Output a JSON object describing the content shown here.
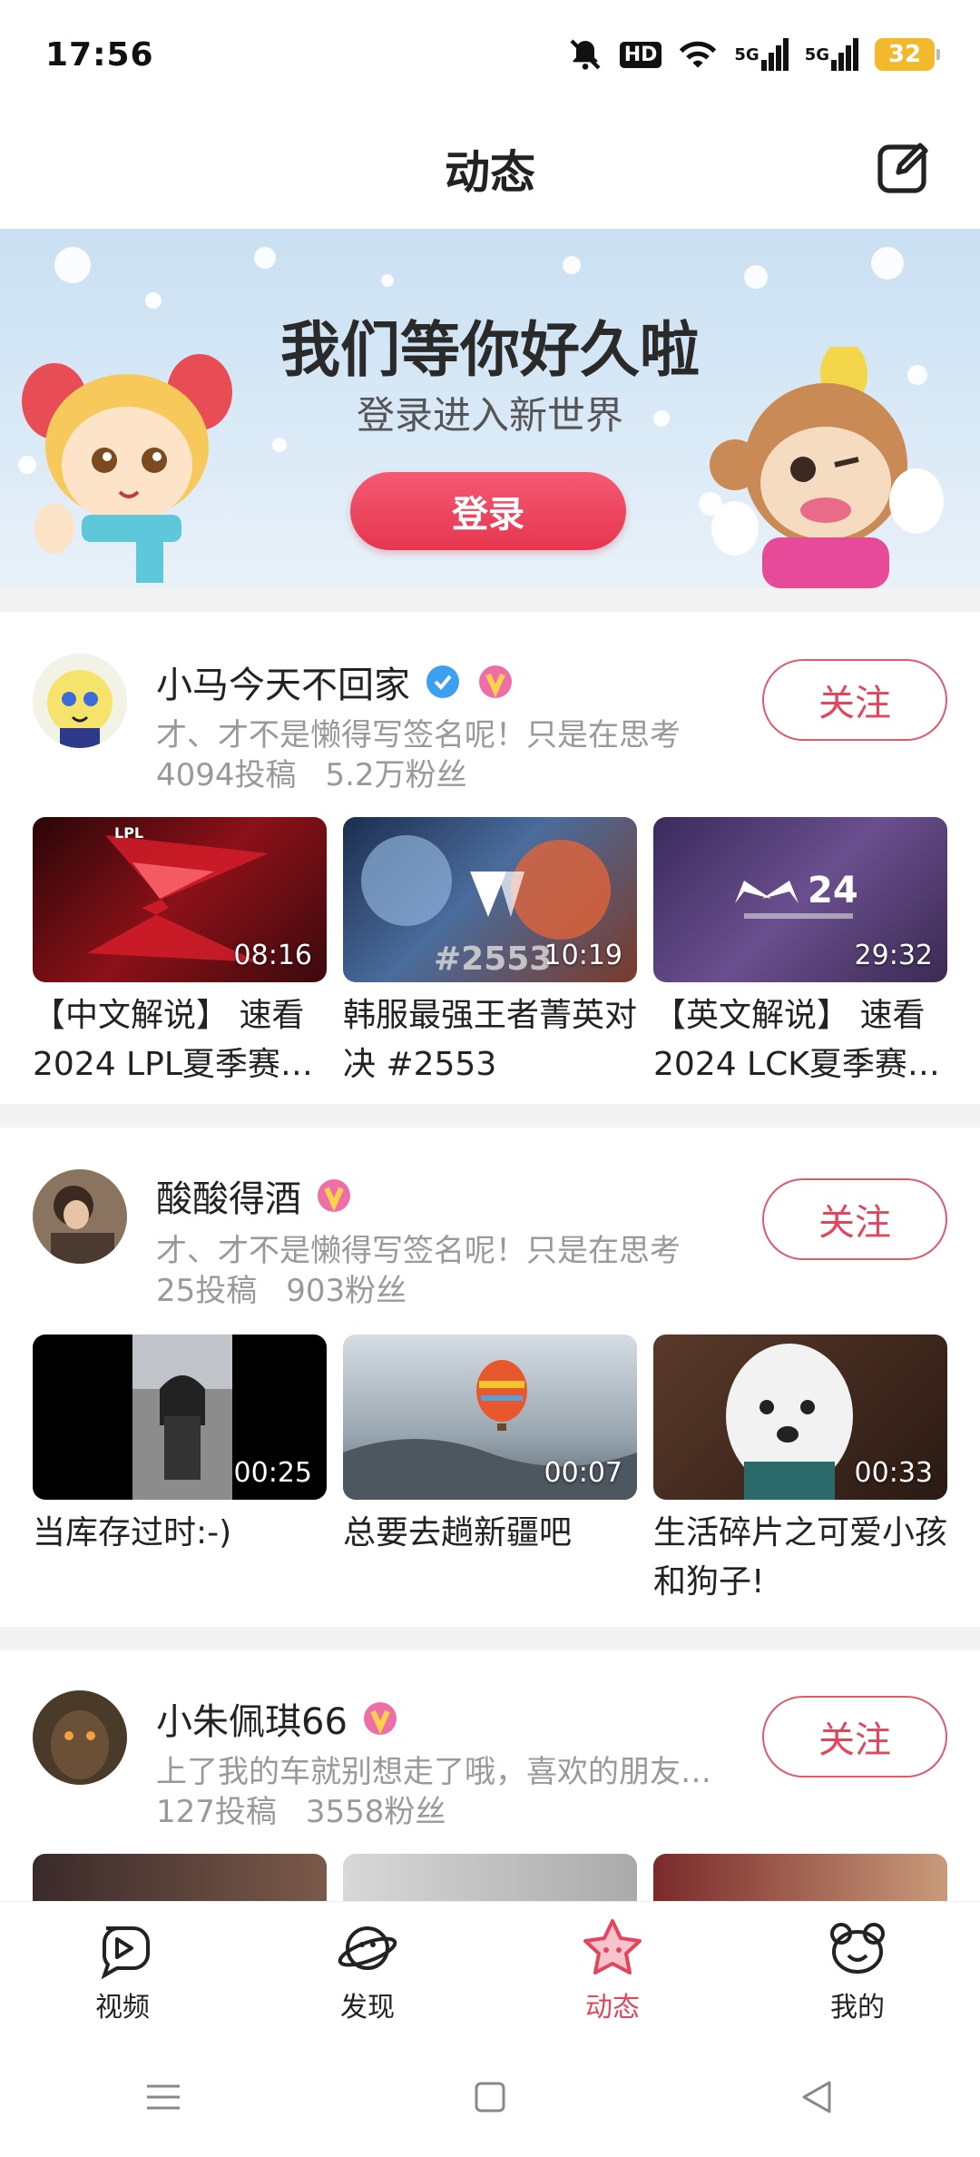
{
  "status_bar": {
    "time": "17:56",
    "hd_label": "HD",
    "net1": "5G",
    "net2": "5G",
    "battery": "32"
  },
  "header": {
    "title": "动态",
    "edit_icon": "edit-icon"
  },
  "banner": {
    "headline": "我们等你好久啦",
    "subline": "登录进入新世界",
    "login_label": "登录"
  },
  "creators": [
    {
      "name": "小马今天不回家",
      "signature": "才、才不是懒得写签名呢！只是在思考",
      "posts": "4094投稿",
      "fans": "5.2万粉丝",
      "follow_label": "关注",
      "videos": [
        {
          "title": "【中文解说】 速看2024 LPL夏季赛…",
          "duration": "08:16",
          "thumb_text": "LPL"
        },
        {
          "title": "韩服最强王者菁英对决 #2553",
          "duration": "10:19",
          "thumb_text": "#2553"
        },
        {
          "title": "【英文解说】 速看2024 LCK夏季赛…",
          "duration": "29:32",
          "thumb_text": "24"
        }
      ]
    },
    {
      "name": "酸酸得酒",
      "signature": "才、才不是懒得写签名呢！只是在思考",
      "posts": "25投稿",
      "fans": "903粉丝",
      "follow_label": "关注",
      "videos": [
        {
          "title": "当库存过时:-)",
          "duration": "00:25"
        },
        {
          "title": "总要去趟新疆吧",
          "duration": "00:07"
        },
        {
          "title": "生活碎片之可爱小孩和狗子!",
          "duration": "00:33"
        }
      ]
    },
    {
      "name": "小朱佩琪66",
      "signature": "上了我的车就别想走了哦，喜欢的朋友…",
      "posts": "127投稿",
      "fans": "3558粉丝",
      "follow_label": "关注"
    }
  ],
  "bottom_nav": [
    {
      "label": "视频",
      "icon": "video-icon",
      "active": false
    },
    {
      "label": "发现",
      "icon": "planet-icon",
      "active": false
    },
    {
      "label": "动态",
      "icon": "star-icon",
      "active": true
    },
    {
      "label": "我的",
      "icon": "bear-icon",
      "active": false
    }
  ],
  "colors": {
    "accent": "#e2465c",
    "muted": "#999999"
  }
}
